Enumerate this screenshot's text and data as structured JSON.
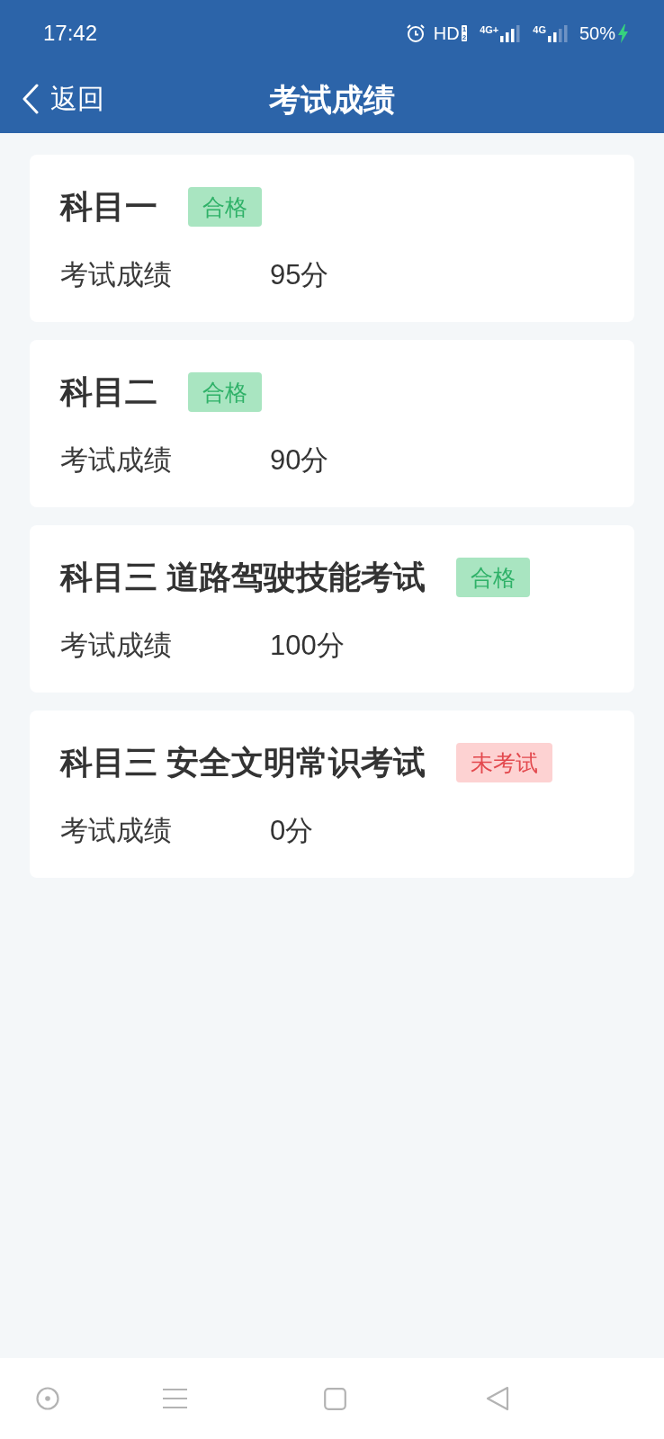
{
  "status_bar": {
    "time": "17:42",
    "hd": "HD",
    "hd_slots": [
      "1",
      "2"
    ],
    "networks": [
      {
        "label": "4G+"
      },
      {
        "label": "4G"
      }
    ],
    "battery": "50%",
    "charging": true
  },
  "header": {
    "back": "返回",
    "title": "考试成绩"
  },
  "results": [
    {
      "subject": "科目一",
      "status": {
        "kind": "passed",
        "label": "合格"
      },
      "score_label": "考试成绩",
      "score": "95分"
    },
    {
      "subject": "科目二",
      "status": {
        "kind": "passed",
        "label": "合格"
      },
      "score_label": "考试成绩",
      "score": "90分"
    },
    {
      "subject": "科目三 道路驾驶技能考试",
      "status": {
        "kind": "passed",
        "label": "合格"
      },
      "score_label": "考试成绩",
      "score": "100分"
    },
    {
      "subject": "科目三 安全文明常识考试",
      "status": {
        "kind": "not_taken",
        "label": "未考试"
      },
      "score_label": "考试成绩",
      "score": "0分"
    }
  ]
}
